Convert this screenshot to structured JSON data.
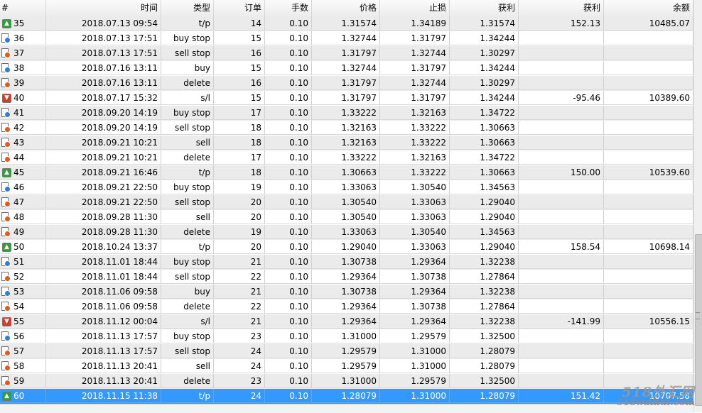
{
  "headers": [
    "#",
    "时间",
    "类型",
    "订单",
    "手数",
    "价格",
    "止损",
    "获利",
    "获利",
    "余额"
  ],
  "rows": [
    {
      "n": "35",
      "time": "2018.07.13 09:54",
      "type": "t/p",
      "order": "14",
      "lots": "0.10",
      "price": "1.31574",
      "sl": "1.34189",
      "tp": "1.31574",
      "profit": "152.13",
      "balance": "10485.07",
      "icon": "take-profit-icon"
    },
    {
      "n": "36",
      "time": "2018.07.13 17:51",
      "type": "buy stop",
      "order": "15",
      "lots": "0.10",
      "price": "1.32744",
      "sl": "1.31797",
      "tp": "1.34244",
      "profit": "",
      "balance": "",
      "icon": "buy-stop-icon"
    },
    {
      "n": "37",
      "time": "2018.07.13 17:51",
      "type": "sell stop",
      "order": "16",
      "lots": "0.10",
      "price": "1.31797",
      "sl": "1.32744",
      "tp": "1.30297",
      "profit": "",
      "balance": "",
      "icon": "sell-stop-icon"
    },
    {
      "n": "38",
      "time": "2018.07.16 13:11",
      "type": "buy",
      "order": "15",
      "lots": "0.10",
      "price": "1.32744",
      "sl": "1.31797",
      "tp": "1.34244",
      "profit": "",
      "balance": "",
      "icon": "buy-icon"
    },
    {
      "n": "39",
      "time": "2018.07.16 13:11",
      "type": "delete",
      "order": "16",
      "lots": "0.10",
      "price": "1.31797",
      "sl": "1.32744",
      "tp": "1.30297",
      "profit": "",
      "balance": "",
      "icon": "delete-order-icon"
    },
    {
      "n": "40",
      "time": "2018.07.17 15:32",
      "type": "s/l",
      "order": "15",
      "lots": "0.10",
      "price": "1.31797",
      "sl": "1.31797",
      "tp": "1.34244",
      "profit": "-95.46",
      "balance": "10389.60",
      "icon": "stop-loss-icon"
    },
    {
      "n": "41",
      "time": "2018.09.20 14:19",
      "type": "buy stop",
      "order": "17",
      "lots": "0.10",
      "price": "1.33222",
      "sl": "1.32163",
      "tp": "1.34722",
      "profit": "",
      "balance": "",
      "icon": "buy-stop-icon"
    },
    {
      "n": "42",
      "time": "2018.09.20 14:19",
      "type": "sell stop",
      "order": "18",
      "lots": "0.10",
      "price": "1.32163",
      "sl": "1.33222",
      "tp": "1.30663",
      "profit": "",
      "balance": "",
      "icon": "sell-stop-icon"
    },
    {
      "n": "43",
      "time": "2018.09.21 10:21",
      "type": "sell",
      "order": "18",
      "lots": "0.10",
      "price": "1.32163",
      "sl": "1.33222",
      "tp": "1.30663",
      "profit": "",
      "balance": "",
      "icon": "sell-icon"
    },
    {
      "n": "44",
      "time": "2018.09.21 10:21",
      "type": "delete",
      "order": "17",
      "lots": "0.10",
      "price": "1.33222",
      "sl": "1.32163",
      "tp": "1.34722",
      "profit": "",
      "balance": "",
      "icon": "delete-order-icon"
    },
    {
      "n": "45",
      "time": "2018.09.21 16:46",
      "type": "t/p",
      "order": "18",
      "lots": "0.10",
      "price": "1.30663",
      "sl": "1.33222",
      "tp": "1.30663",
      "profit": "150.00",
      "balance": "10539.60",
      "icon": "take-profit-icon"
    },
    {
      "n": "46",
      "time": "2018.09.21 22:50",
      "type": "buy stop",
      "order": "19",
      "lots": "0.10",
      "price": "1.33063",
      "sl": "1.30540",
      "tp": "1.34563",
      "profit": "",
      "balance": "",
      "icon": "buy-stop-icon"
    },
    {
      "n": "47",
      "time": "2018.09.21 22:50",
      "type": "sell stop",
      "order": "20",
      "lots": "0.10",
      "price": "1.30540",
      "sl": "1.33063",
      "tp": "1.29040",
      "profit": "",
      "balance": "",
      "icon": "sell-stop-icon"
    },
    {
      "n": "48",
      "time": "2018.09.28 11:30",
      "type": "sell",
      "order": "20",
      "lots": "0.10",
      "price": "1.30540",
      "sl": "1.33063",
      "tp": "1.29040",
      "profit": "",
      "balance": "",
      "icon": "sell-icon"
    },
    {
      "n": "49",
      "time": "2018.09.28 11:30",
      "type": "delete",
      "order": "19",
      "lots": "0.10",
      "price": "1.33063",
      "sl": "1.30540",
      "tp": "1.34563",
      "profit": "",
      "balance": "",
      "icon": "delete-order-icon"
    },
    {
      "n": "50",
      "time": "2018.10.24 13:37",
      "type": "t/p",
      "order": "20",
      "lots": "0.10",
      "price": "1.29040",
      "sl": "1.33063",
      "tp": "1.29040",
      "profit": "158.54",
      "balance": "10698.14",
      "icon": "take-profit-icon"
    },
    {
      "n": "51",
      "time": "2018.11.01 18:44",
      "type": "buy stop",
      "order": "21",
      "lots": "0.10",
      "price": "1.30738",
      "sl": "1.29364",
      "tp": "1.32238",
      "profit": "",
      "balance": "",
      "icon": "buy-stop-icon"
    },
    {
      "n": "52",
      "time": "2018.11.01 18:44",
      "type": "sell stop",
      "order": "22",
      "lots": "0.10",
      "price": "1.29364",
      "sl": "1.30738",
      "tp": "1.27864",
      "profit": "",
      "balance": "",
      "icon": "sell-stop-icon"
    },
    {
      "n": "53",
      "time": "2018.11.06 09:58",
      "type": "buy",
      "order": "21",
      "lots": "0.10",
      "price": "1.30738",
      "sl": "1.29364",
      "tp": "1.32238",
      "profit": "",
      "balance": "",
      "icon": "buy-icon"
    },
    {
      "n": "54",
      "time": "2018.11.06 09:58",
      "type": "delete",
      "order": "22",
      "lots": "0.10",
      "price": "1.29364",
      "sl": "1.30738",
      "tp": "1.27864",
      "profit": "",
      "balance": "",
      "icon": "delete-order-icon"
    },
    {
      "n": "55",
      "time": "2018.11.12 00:04",
      "type": "s/l",
      "order": "21",
      "lots": "0.10",
      "price": "1.29364",
      "sl": "1.29364",
      "tp": "1.32238",
      "profit": "-141.99",
      "balance": "10556.15",
      "icon": "stop-loss-icon"
    },
    {
      "n": "56",
      "time": "2018.11.13 17:57",
      "type": "buy stop",
      "order": "23",
      "lots": "0.10",
      "price": "1.31000",
      "sl": "1.29579",
      "tp": "1.32500",
      "profit": "",
      "balance": "",
      "icon": "buy-stop-icon"
    },
    {
      "n": "57",
      "time": "2018.11.13 17:57",
      "type": "sell stop",
      "order": "24",
      "lots": "0.10",
      "price": "1.29579",
      "sl": "1.31000",
      "tp": "1.28079",
      "profit": "",
      "balance": "",
      "icon": "sell-stop-icon"
    },
    {
      "n": "58",
      "time": "2018.11.13 20:41",
      "type": "sell",
      "order": "24",
      "lots": "0.10",
      "price": "1.29579",
      "sl": "1.31000",
      "tp": "1.28079",
      "profit": "",
      "balance": "",
      "icon": "sell-icon"
    },
    {
      "n": "59",
      "time": "2018.11.13 20:41",
      "type": "delete",
      "order": "23",
      "lots": "0.10",
      "price": "1.31000",
      "sl": "1.29579",
      "tp": "1.32500",
      "profit": "",
      "balance": "",
      "icon": "delete-order-icon"
    },
    {
      "n": "60",
      "time": "2018.11.15 11:38",
      "type": "t/p",
      "order": "24",
      "lots": "0.10",
      "price": "1.28079",
      "sl": "1.31000",
      "tp": "1.28079",
      "profit": "151.42",
      "balance": "10707.58",
      "icon": "take-profit-icon",
      "selected": true
    }
  ],
  "watermark": {
    "line1": "518外汇网",
    "line2": "518waihui.com"
  },
  "colors": {
    "selection": "#3399ff",
    "stripe": "#ebebeb",
    "up": "#2f9e3a",
    "down": "#d23b2a",
    "buy": "#2f7fd6",
    "sell": "#e35a1f"
  }
}
